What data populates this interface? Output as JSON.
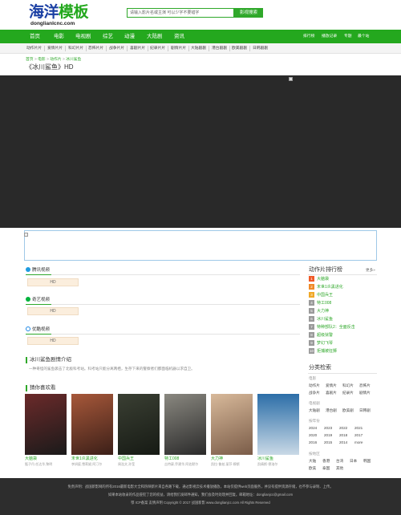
{
  "header": {
    "logo_part1": "海洋",
    "logo_part2": "模板",
    "logo_domain": "donglianlcnc.com",
    "search_placeholder": "请输入影片名或主演 可以少字不要错字",
    "search_button": "影视搜索"
  },
  "nav": {
    "items": [
      "首页",
      "电影",
      "电视剧",
      "综艺",
      "动漫",
      "大陆剧",
      "资讯"
    ],
    "right_items": [
      "排行榜",
      "播放记录",
      "专题",
      "最个站"
    ]
  },
  "subnav": {
    "items": [
      "动作片片",
      "爱情片片",
      "科幻片片",
      "恐怖片片",
      "战争片片",
      "喜剧片片",
      "纪录片片",
      "剧情片片",
      "大陆剧剧",
      "港台剧剧",
      "欧美剧剧",
      "日韩剧剧"
    ]
  },
  "breadcrumb": {
    "home": "首页",
    "sep": ">",
    "level1": "电影",
    "level2": "动作片",
    "level3": "冰川鲨鱼"
  },
  "page_title": "《冰川鲨鱼》HD",
  "sources": [
    {
      "name": "腾讯视频",
      "color": "#1f9be0",
      "button": "HD"
    },
    {
      "name": "奇艺视频",
      "color": "#00b33c",
      "button": "HD"
    },
    {
      "name": "优酷视频",
      "color": "#1e88e5",
      "button": "HD"
    }
  ],
  "intro": {
    "heading": "冰川鲨鱼剧情介绍",
    "text": "一种奇怪的鲨鱼袭击了北极科考站。科考站只能分离两栖，生存下来的警察者们都面临机器以求自卫。"
  },
  "recommend": {
    "heading": "猜你喜欢看",
    "items": [
      {
        "name": "大脑袋",
        "desc": "甄子丹,任达华,黎明",
        "color1": "#6b2a2a",
        "color2": "#1a1a1a"
      },
      {
        "name": "末世1炎黑进化",
        "desc": "李妍庭,雪莉妮,阿汀尔",
        "color1": "#a7583a",
        "color2": "#3b1f18"
      },
      {
        "name": "中国兵王",
        "desc": "周浩文,孙莹",
        "color1": "#3a3f33",
        "color2": "#161a14"
      },
      {
        "name": "特工008",
        "desc": "吉特豪,乔建华,阿佐默尔",
        "color1": "#8a8880",
        "color2": "#2a2a2a"
      },
      {
        "name": "大力神",
        "desc": "凯拉·鲁兹,丽莎·穆斯",
        "color1": "#d8b99a",
        "color2": "#7a5c48"
      },
      {
        "name": "冰川鲨鱼",
        "desc": "凯倩斯·德洛尔",
        "color1": "#2c6ea8",
        "color2": "#c9d9e6"
      }
    ]
  },
  "ranking": {
    "title": "动作片排行榜",
    "more": "更多»",
    "items": [
      {
        "num": "1",
        "name": "大脑袋",
        "color": "#f05a28"
      },
      {
        "num": "2",
        "name": "末世1炎黑进化",
        "color": "#f08a28"
      },
      {
        "num": "3",
        "name": "中国兵王",
        "color": "#f0a828"
      },
      {
        "num": "4",
        "name": "特工008",
        "color": "#9a9a9a"
      },
      {
        "num": "5",
        "name": "大力神",
        "color": "#9a9a9a"
      },
      {
        "num": "6",
        "name": "冰川鲨鱼",
        "color": "#9a9a9a"
      },
      {
        "num": "7",
        "name": "特种部队2：全面反击",
        "color": "#9a9a9a"
      },
      {
        "num": "8",
        "name": "超级狱警",
        "color": "#9a9a9a"
      },
      {
        "num": "9",
        "name": "梦幻飞琴",
        "color": "#9a9a9a"
      },
      {
        "num": "10",
        "name": "拒捕被狂狮",
        "color": "#9a9a9a"
      }
    ]
  },
  "categories": {
    "title": "分类检索",
    "type_label": "电影",
    "types": [
      "动作片",
      "爱情片",
      "科幻片",
      "恐怖片",
      "战争片",
      "喜剧片",
      "纪录片",
      "剧情片"
    ],
    "tv_label": "电视剧",
    "tv": [
      "大陆剧",
      "港台剧",
      "欧美剧",
      "日韩剧"
    ],
    "year_label": "按年份",
    "years": [
      "2024",
      "2023",
      "2022",
      "2021",
      "2020",
      "2019",
      "2018",
      "2017",
      "2016",
      "2015",
      "2014",
      "more"
    ],
    "region_label": "按地区",
    "regions": [
      "大陆",
      "香港",
      "台湾",
      "日本",
      "韩国",
      "欧美",
      "泰国",
      "其他"
    ]
  },
  "footer": {
    "line1": "免责声明：战国新影网的所有2016最新电影大全和热映新片来自各路下载，通过影视云技术播放播放，本站仅提供web页面服务，并没有提供资源存储，也不参与录制、上传。",
    "line2": "如果本站收录的作品侵犯了您的权益，请给我们发邮件通知，我们会及时处理并回复。邮箱地址：donglianjcc@gmail.com",
    "line3": "鄂 ICP备案 友情声明  Copyright © 2017 战国新影 www.donglianjcc.com All Rights Reserved"
  }
}
